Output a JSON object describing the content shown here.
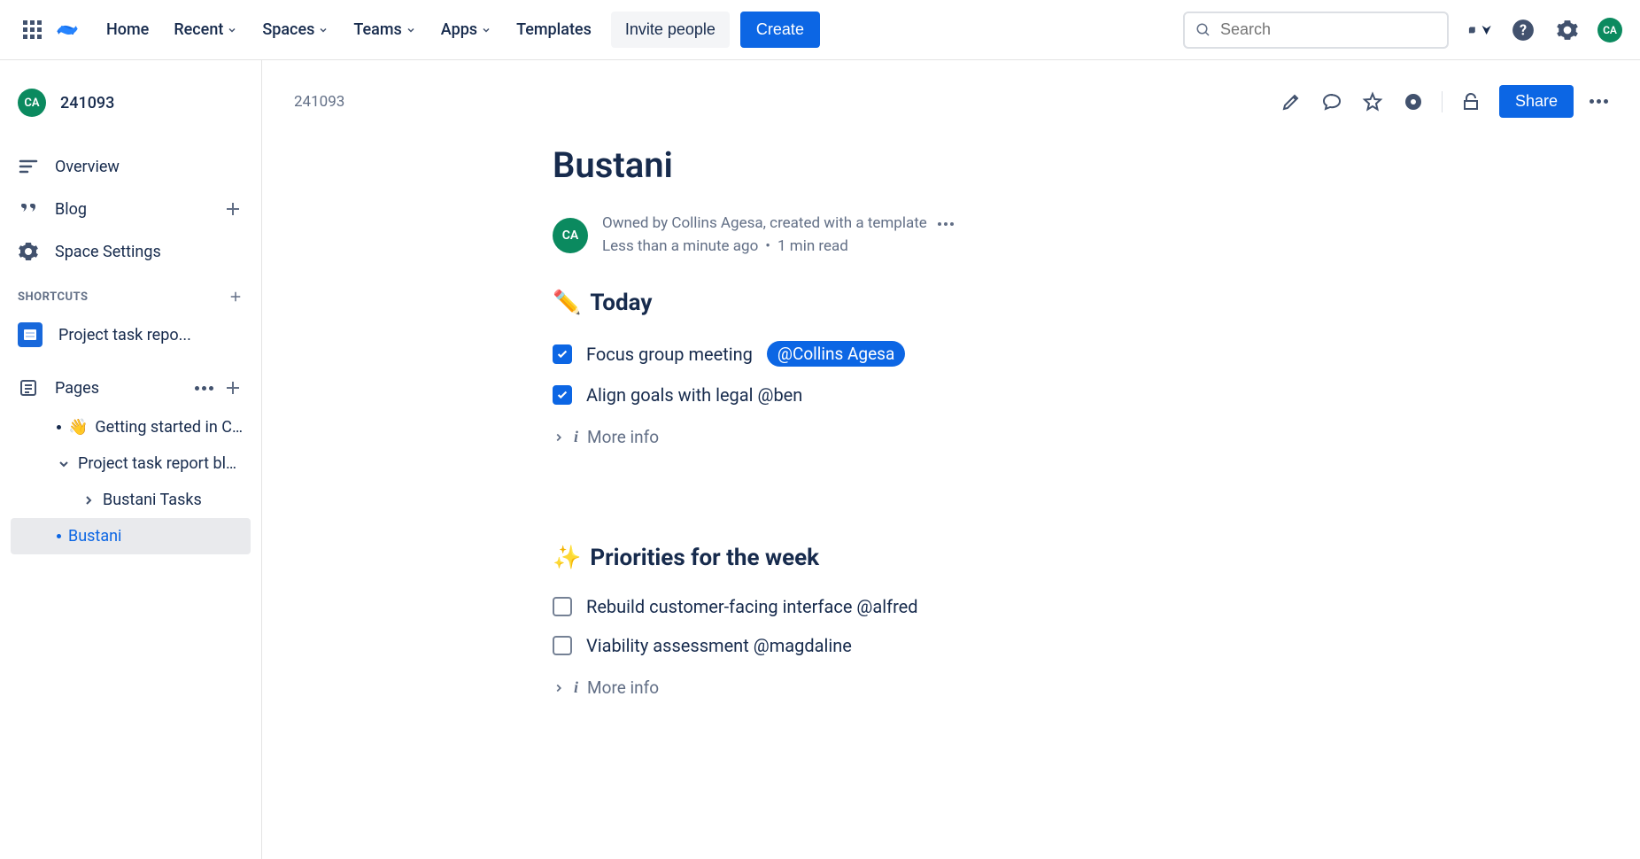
{
  "topbar": {
    "nav": {
      "home": "Home",
      "recent": "Recent",
      "spaces": "Spaces",
      "teams": "Teams",
      "apps": "Apps",
      "templates": "Templates"
    },
    "invite": "Invite people",
    "create": "Create",
    "search_placeholder": "Search",
    "avatar_initials": "CA"
  },
  "sidebar": {
    "space_initials": "CA",
    "space_name": "241093",
    "overview": "Overview",
    "blog": "Blog",
    "settings": "Space Settings",
    "shortcuts_label": "SHORTCUTS",
    "shortcut1": "Project task repo...",
    "pages_label": "Pages",
    "tree": {
      "getting_started": "Getting started in C...",
      "project_blueprint": "Project task report blu...",
      "bustani_tasks": "Bustani Tasks",
      "bustani": "Bustani"
    }
  },
  "page": {
    "breadcrumb": "241093",
    "share": "Share",
    "title": "Bustani",
    "owner_initials": "CA",
    "owner_line": "Owned by Collins Agesa, created with a template",
    "time_ago": "Less than a minute ago",
    "read_time": "1 min read",
    "today_emoji": "✏️",
    "today_heading": "Today",
    "priorities_emoji": "✨",
    "priorities_heading": "Priorities for the week",
    "more_info": "More info",
    "tasks_today": {
      "t1_text": "Focus group meeting ",
      "t1_mention": "@Collins Agesa",
      "t2_text": "Align goals with legal @ben"
    },
    "tasks_week": {
      "w1_text": "Rebuild customer-facing interface @alfred",
      "w2_text": "Viability assessment @magdaline"
    }
  }
}
